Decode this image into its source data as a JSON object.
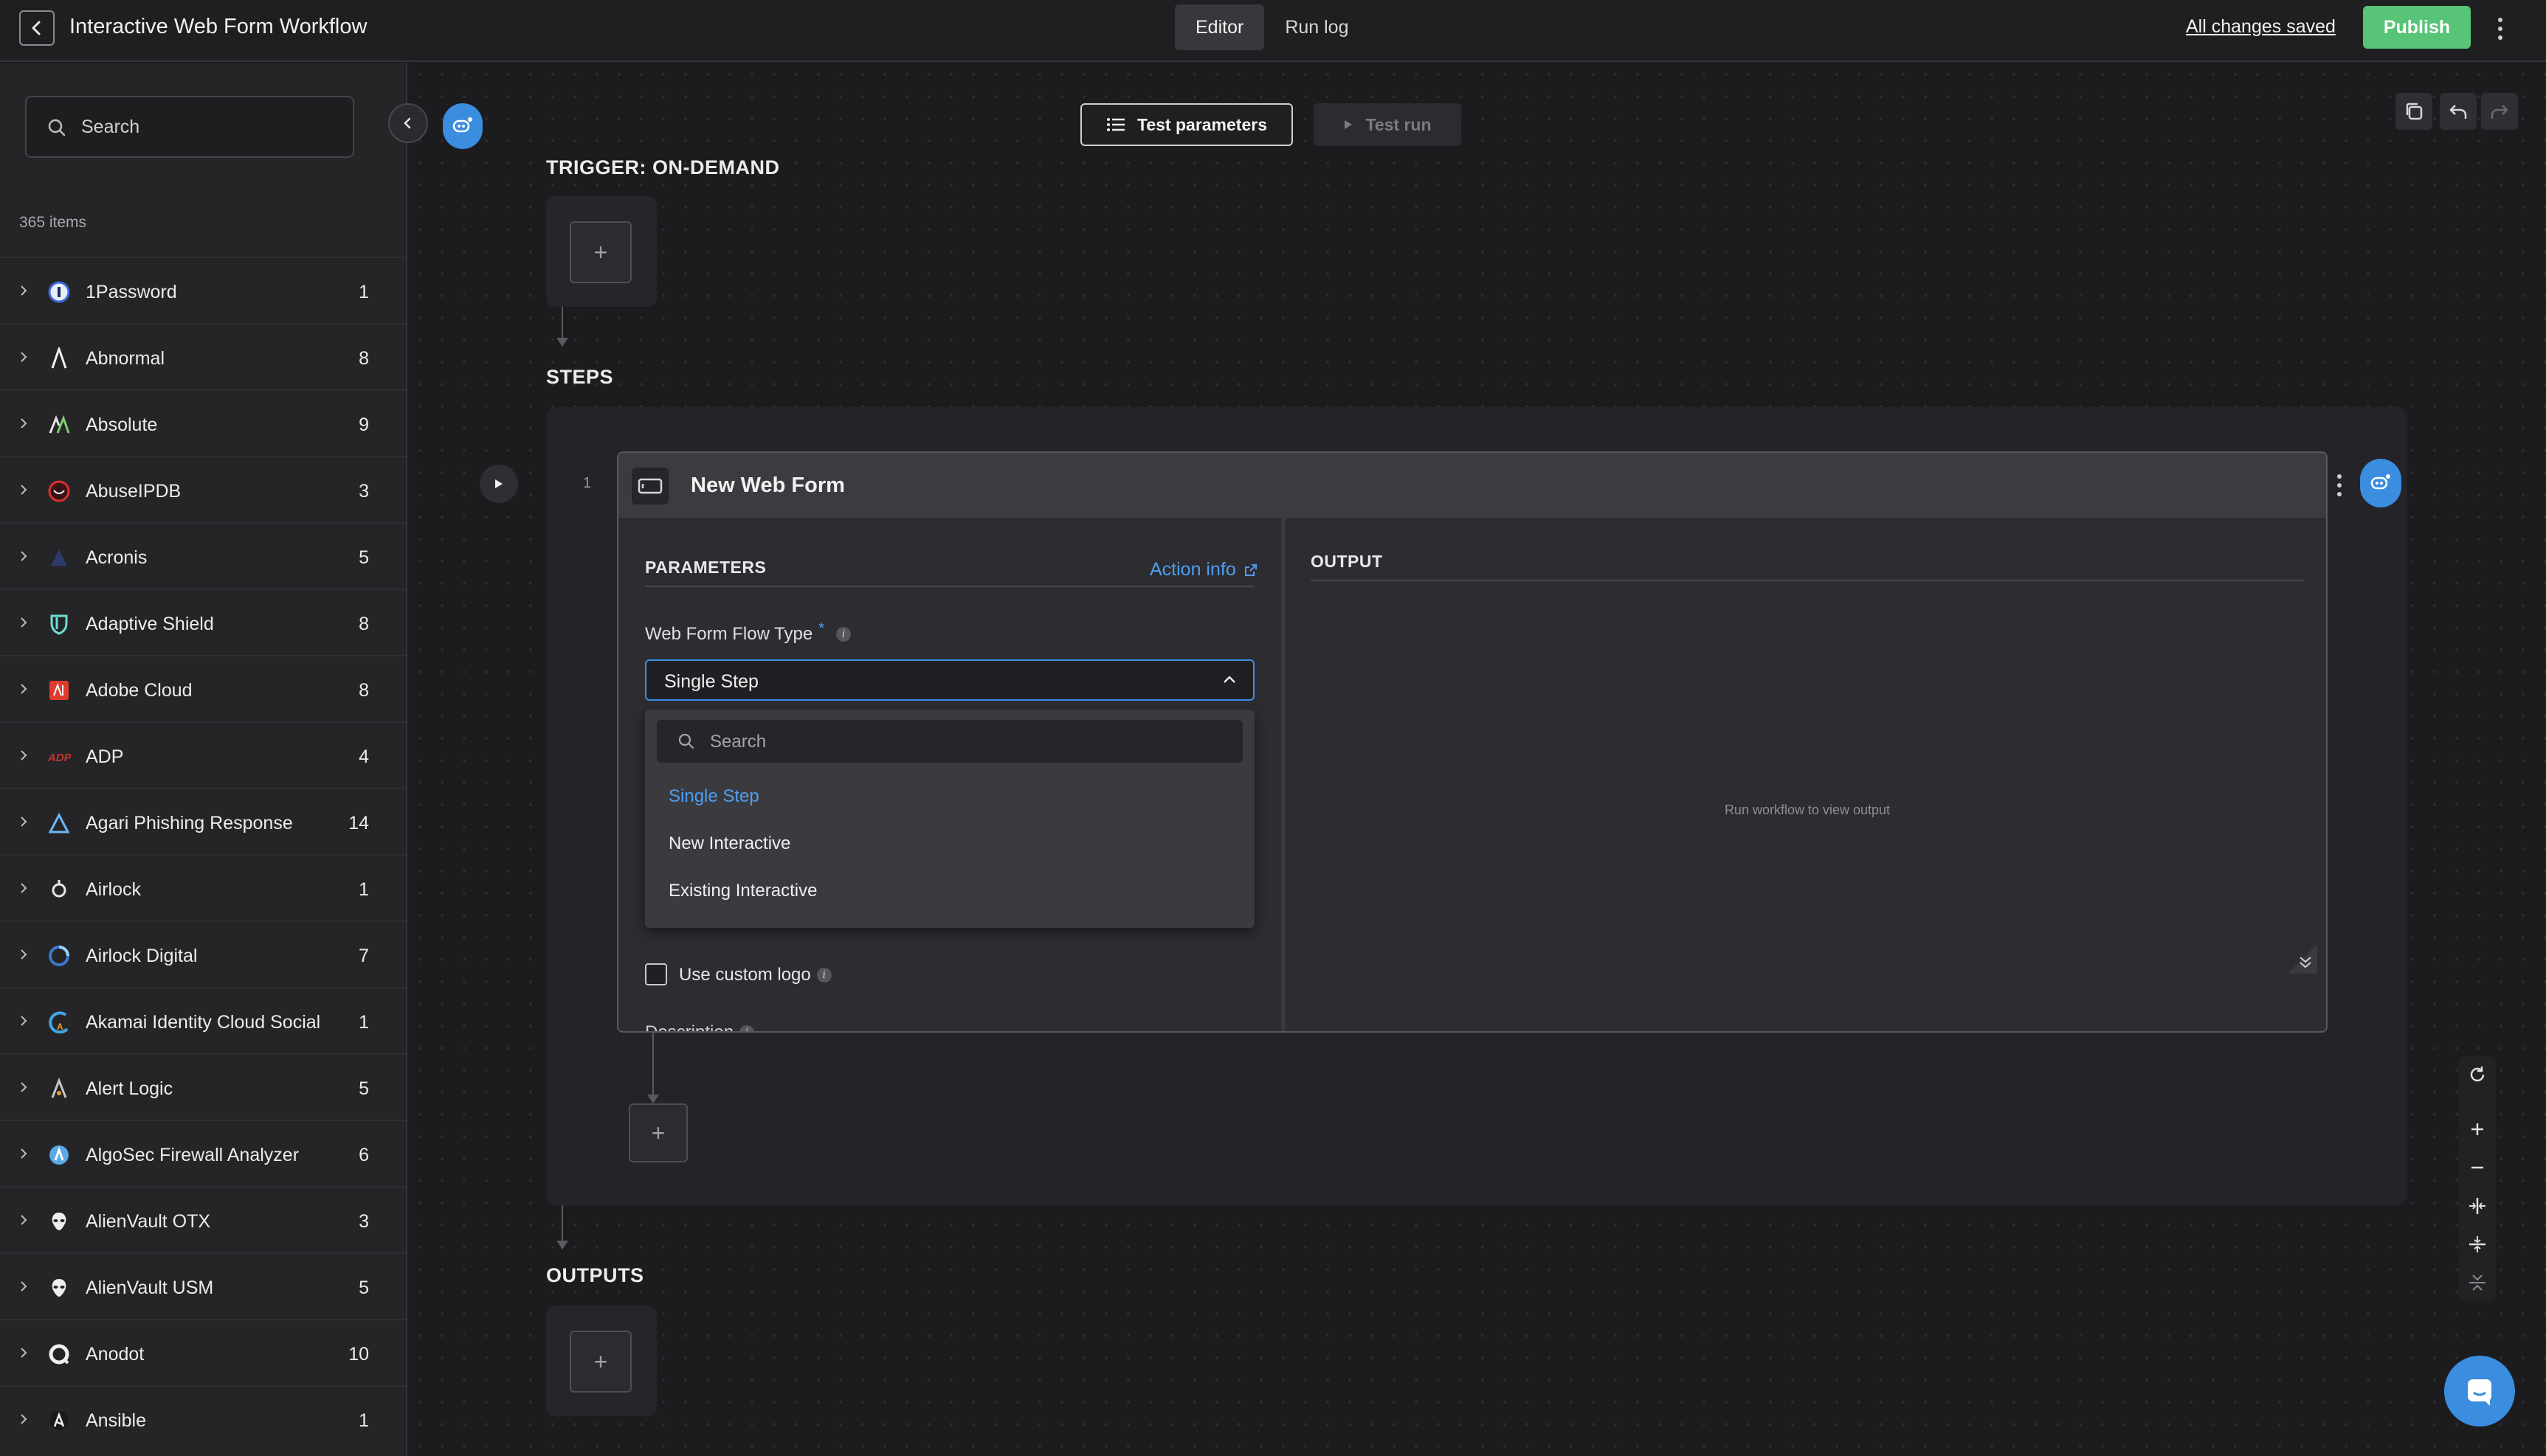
{
  "header": {
    "title": "Interactive Web Form Workflow",
    "tabs": [
      {
        "label": "Editor",
        "active": true
      },
      {
        "label": "Run log",
        "active": false
      }
    ],
    "saved_status": "All changes saved",
    "publish_label": "Publish"
  },
  "sidebar": {
    "search_placeholder": "Search",
    "item_count": "365 items",
    "items": [
      {
        "name": "1Password",
        "count": "1",
        "icon": "1password-logo"
      },
      {
        "name": "Abnormal",
        "count": "8",
        "icon": "abnormal-logo"
      },
      {
        "name": "Absolute",
        "count": "9",
        "icon": "absolute-logo"
      },
      {
        "name": "AbuseIPDB",
        "count": "3",
        "icon": "abuseipdb-logo"
      },
      {
        "name": "Acronis",
        "count": "5",
        "icon": "acronis-logo"
      },
      {
        "name": "Adaptive Shield",
        "count": "8",
        "icon": "adaptive-shield-logo"
      },
      {
        "name": "Adobe Cloud",
        "count": "8",
        "icon": "adobe-logo"
      },
      {
        "name": "ADP",
        "count": "4",
        "icon": "adp-logo"
      },
      {
        "name": "Agari Phishing Response",
        "count": "14",
        "icon": "agari-logo"
      },
      {
        "name": "Airlock",
        "count": "1",
        "icon": "airlock-logo"
      },
      {
        "name": "Airlock Digital",
        "count": "7",
        "icon": "airlock-digital-logo"
      },
      {
        "name": "Akamai Identity Cloud Social",
        "count": "1",
        "icon": "akamai-logo"
      },
      {
        "name": "Alert Logic",
        "count": "5",
        "icon": "alert-logic-logo"
      },
      {
        "name": "AlgoSec Firewall Analyzer",
        "count": "6",
        "icon": "algosec-logo"
      },
      {
        "name": "AlienVault OTX",
        "count": "3",
        "icon": "alienvault-logo"
      },
      {
        "name": "AlienVault USM",
        "count": "5",
        "icon": "alienvault-logo"
      },
      {
        "name": "Anodot",
        "count": "10",
        "icon": "anodot-logo"
      },
      {
        "name": "Ansible",
        "count": "1",
        "icon": "ansible-logo"
      }
    ]
  },
  "toolbar": {
    "test_parameters_label": "Test parameters",
    "test_run_label": "Test run"
  },
  "canvas": {
    "trigger_title": "TRIGGER: ON-DEMAND",
    "steps_title": "STEPS",
    "outputs_title": "OUTPUTS",
    "add_symbol": "+"
  },
  "step": {
    "number": "1",
    "title": "New Web Form",
    "parameters_heading": "PARAMETERS",
    "action_info_label": "Action info",
    "output_heading": "OUTPUT",
    "output_empty": "Run workflow to view output",
    "field_label": "Web Form Flow Type",
    "required_mark": "*",
    "info_mark": "i",
    "selected_value": "Single Step",
    "dropdown": {
      "search_placeholder": "Search",
      "options": [
        "Single Step",
        "New Interactive",
        "Existing Interactive"
      ],
      "selected_index": 0
    },
    "custom_logo_label": "Use custom logo",
    "custom_logo_checked": false,
    "description_label": "Description"
  },
  "colors": {
    "accent": "#3d8ee6",
    "publish": "#57c478",
    "background": "#1d1d21"
  }
}
